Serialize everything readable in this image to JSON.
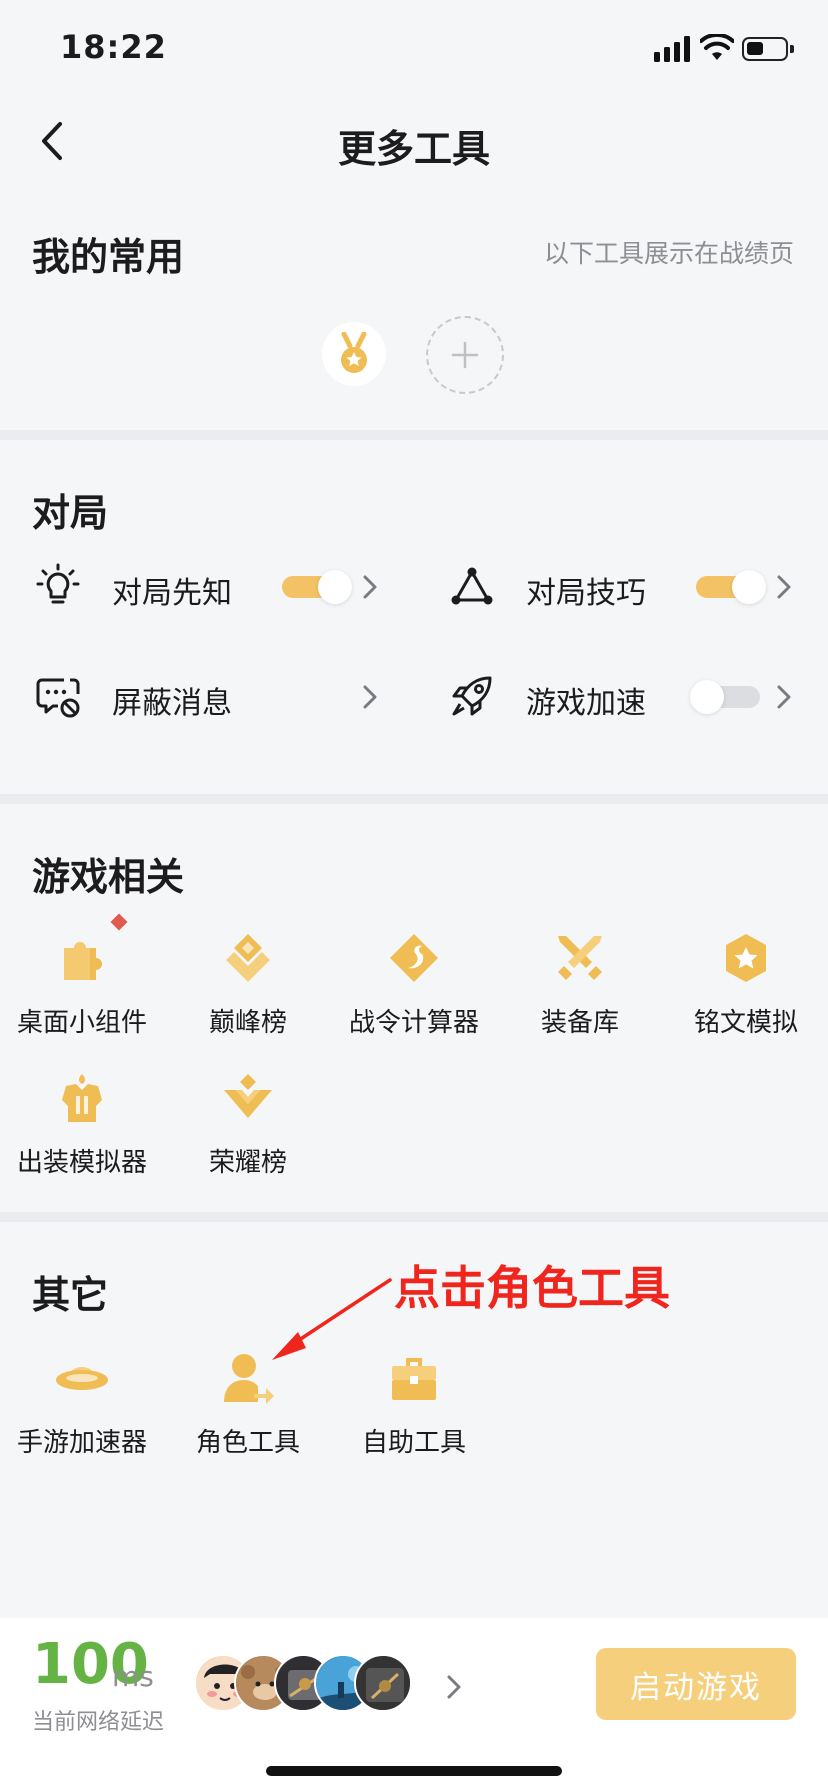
{
  "status_bar": {
    "time": "18:22",
    "signal_icon": "cellular-signal-icon",
    "wifi_icon": "wifi-icon",
    "battery_icon": "battery-icon"
  },
  "nav": {
    "title": "更多工具",
    "back_icon": "chevron-left-icon"
  },
  "favorites": {
    "title": "我的常用",
    "note": "以下工具展示在战绩页",
    "items": [
      {
        "icon": "medal-icon"
      }
    ],
    "add_icon": "plus-icon"
  },
  "match": {
    "title": "对局",
    "items": [
      {
        "label": "对局先知",
        "icon": "lightbulb-icon",
        "toggle": "on"
      },
      {
        "label": "对局技巧",
        "icon": "triangle-nodes-icon",
        "toggle": "on"
      },
      {
        "label": "屏蔽消息",
        "icon": "message-block-icon",
        "toggle": null
      },
      {
        "label": "游戏加速",
        "icon": "rocket-icon",
        "toggle": "off"
      }
    ]
  },
  "game": {
    "title": "游戏相关",
    "items": [
      {
        "label": "桌面小组件",
        "icon": "puzzle-icon",
        "badge": true
      },
      {
        "label": "巅峰榜",
        "icon": "peak-diamond-icon"
      },
      {
        "label": "战令计算器",
        "icon": "dragon-diamond-icon"
      },
      {
        "label": "装备库",
        "icon": "crossed-swords-icon"
      },
      {
        "label": "铭文模拟",
        "icon": "star-hexagon-icon"
      },
      {
        "label": "出装模拟器",
        "icon": "armor-icon"
      },
      {
        "label": "荣耀榜",
        "icon": "glory-chevron-icon"
      }
    ]
  },
  "other": {
    "title": "其它",
    "items": [
      {
        "label": "手游加速器",
        "icon": "ufo-icon"
      },
      {
        "label": "角色工具",
        "icon": "user-switch-icon"
      },
      {
        "label": "自助工具",
        "icon": "toolbox-icon"
      }
    ]
  },
  "annotation": {
    "text": "点击角色工具",
    "color": "#f0251d"
  },
  "bottom_bar": {
    "latency_value": "100",
    "latency_unit": "ms",
    "latency_label": "当前网络延迟",
    "start_button": "启动游戏",
    "friend_avatars": [
      "avatar-1",
      "avatar-2",
      "avatar-3",
      "avatar-4",
      "avatar-5"
    ]
  },
  "colors": {
    "accent": "#f2c265",
    "latency_green": "#66b345",
    "start_button": "#f6cf7c",
    "icon_gold": "#f0bd55"
  }
}
